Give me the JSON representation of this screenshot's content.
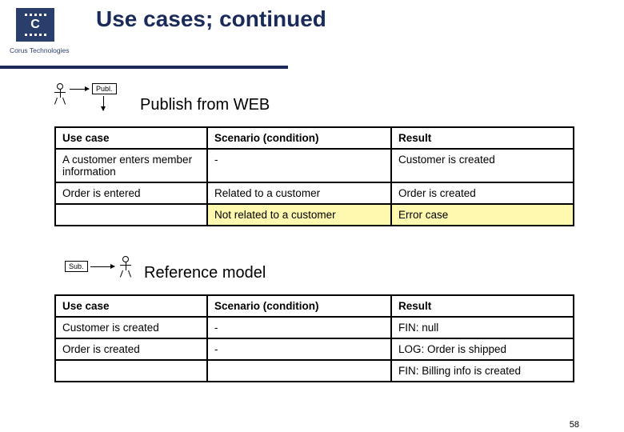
{
  "logo": {
    "company": "Corus Technologies"
  },
  "title": "Use cases; continued",
  "diagrams": {
    "publish_label": "Publ.",
    "subscribe_label": "Sub."
  },
  "sections": {
    "publish_heading": "Publish from WEB",
    "reference_heading": "Reference model"
  },
  "table1": {
    "headers": {
      "a": "Use case",
      "b": "Scenario (condition)",
      "c": "Result"
    },
    "rows": [
      {
        "a": "A customer enters member information",
        "b": "-",
        "c": "Customer is created",
        "hl": false
      },
      {
        "a": "Order is entered",
        "b": "Related to a customer",
        "c": "Order is created",
        "hl": false
      },
      {
        "a": "",
        "b": "Not related to a customer",
        "c": "Error case",
        "hl": true
      }
    ]
  },
  "table2": {
    "headers": {
      "a": "Use case",
      "b": "Scenario (condition)",
      "c": "Result"
    },
    "rows": [
      {
        "a": "Customer is created",
        "b": "-",
        "c": "FIN: null"
      },
      {
        "a": "Order is created",
        "b": "-",
        "c": "LOG: Order is shipped"
      },
      {
        "a": "",
        "b": "",
        "c": "FIN: Billing info is created"
      }
    ]
  },
  "page_number": "58"
}
